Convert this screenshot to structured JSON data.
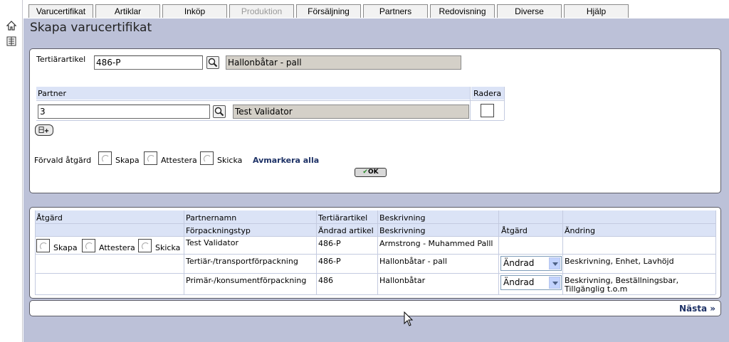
{
  "nav": {
    "tabs": [
      {
        "label": "Varucertifikat",
        "enabled": true
      },
      {
        "label": "Artiklar",
        "enabled": true
      },
      {
        "label": "Inköp",
        "enabled": true
      },
      {
        "label": "Produktion",
        "enabled": false
      },
      {
        "label": "Försäljning",
        "enabled": true
      },
      {
        "label": "Partners",
        "enabled": true
      },
      {
        "label": "Redovisning",
        "enabled": true
      },
      {
        "label": "Diverse",
        "enabled": true
      },
      {
        "label": "Hjälp",
        "enabled": true
      }
    ],
    "sidebar_icons": [
      "home-icon",
      "list-icon"
    ]
  },
  "page": {
    "title": "Skapa varucertifikat"
  },
  "form": {
    "tertiary_label": "Tertiärartikel",
    "tertiary_value": "486-P",
    "tertiary_description": "Hallonbåtar - pall",
    "partner_header": "Partner",
    "delete_header": "Radera",
    "partner_value": "3",
    "partner_name": "Test Validator",
    "default_action_label": "Förvald åtgärd",
    "options": [
      "Skapa",
      "Attestera",
      "Skicka"
    ],
    "deselect_all": "Avmarkera alla",
    "ok_label": "OK"
  },
  "grid": {
    "header_row1": [
      "Åtgärd",
      "Partnernamn",
      "Tertiärartikel",
      "Beskrivning",
      "",
      ""
    ],
    "header_row2": [
      "",
      "Förpackningstyp",
      "Ändrad artikel",
      "Beskrivning",
      "Åtgärd",
      "Ändring"
    ],
    "action_options": [
      "Skapa",
      "Attestera",
      "Skicka"
    ],
    "partner_row": {
      "name": "Test Validator",
      "article": "486-P",
      "description": "Armstrong - Muhammed Palll"
    },
    "rows": [
      {
        "type": "Tertiär-/transportförpackning",
        "article": "486-P",
        "description": "Hallonbåtar - pall",
        "action": "Ändrad",
        "change": "Beskrivning, Enhet, Lavhöjd"
      },
      {
        "type": "Primär-/konsumentförpackning",
        "article": "486",
        "description": "Hallonbåtar",
        "action": "Ändrad",
        "change": "Beskrivning, Beställningsbar,",
        "change_line2": "Tillgänglig t.o.m"
      }
    ]
  },
  "footer": {
    "next_label": "Nästa »"
  }
}
